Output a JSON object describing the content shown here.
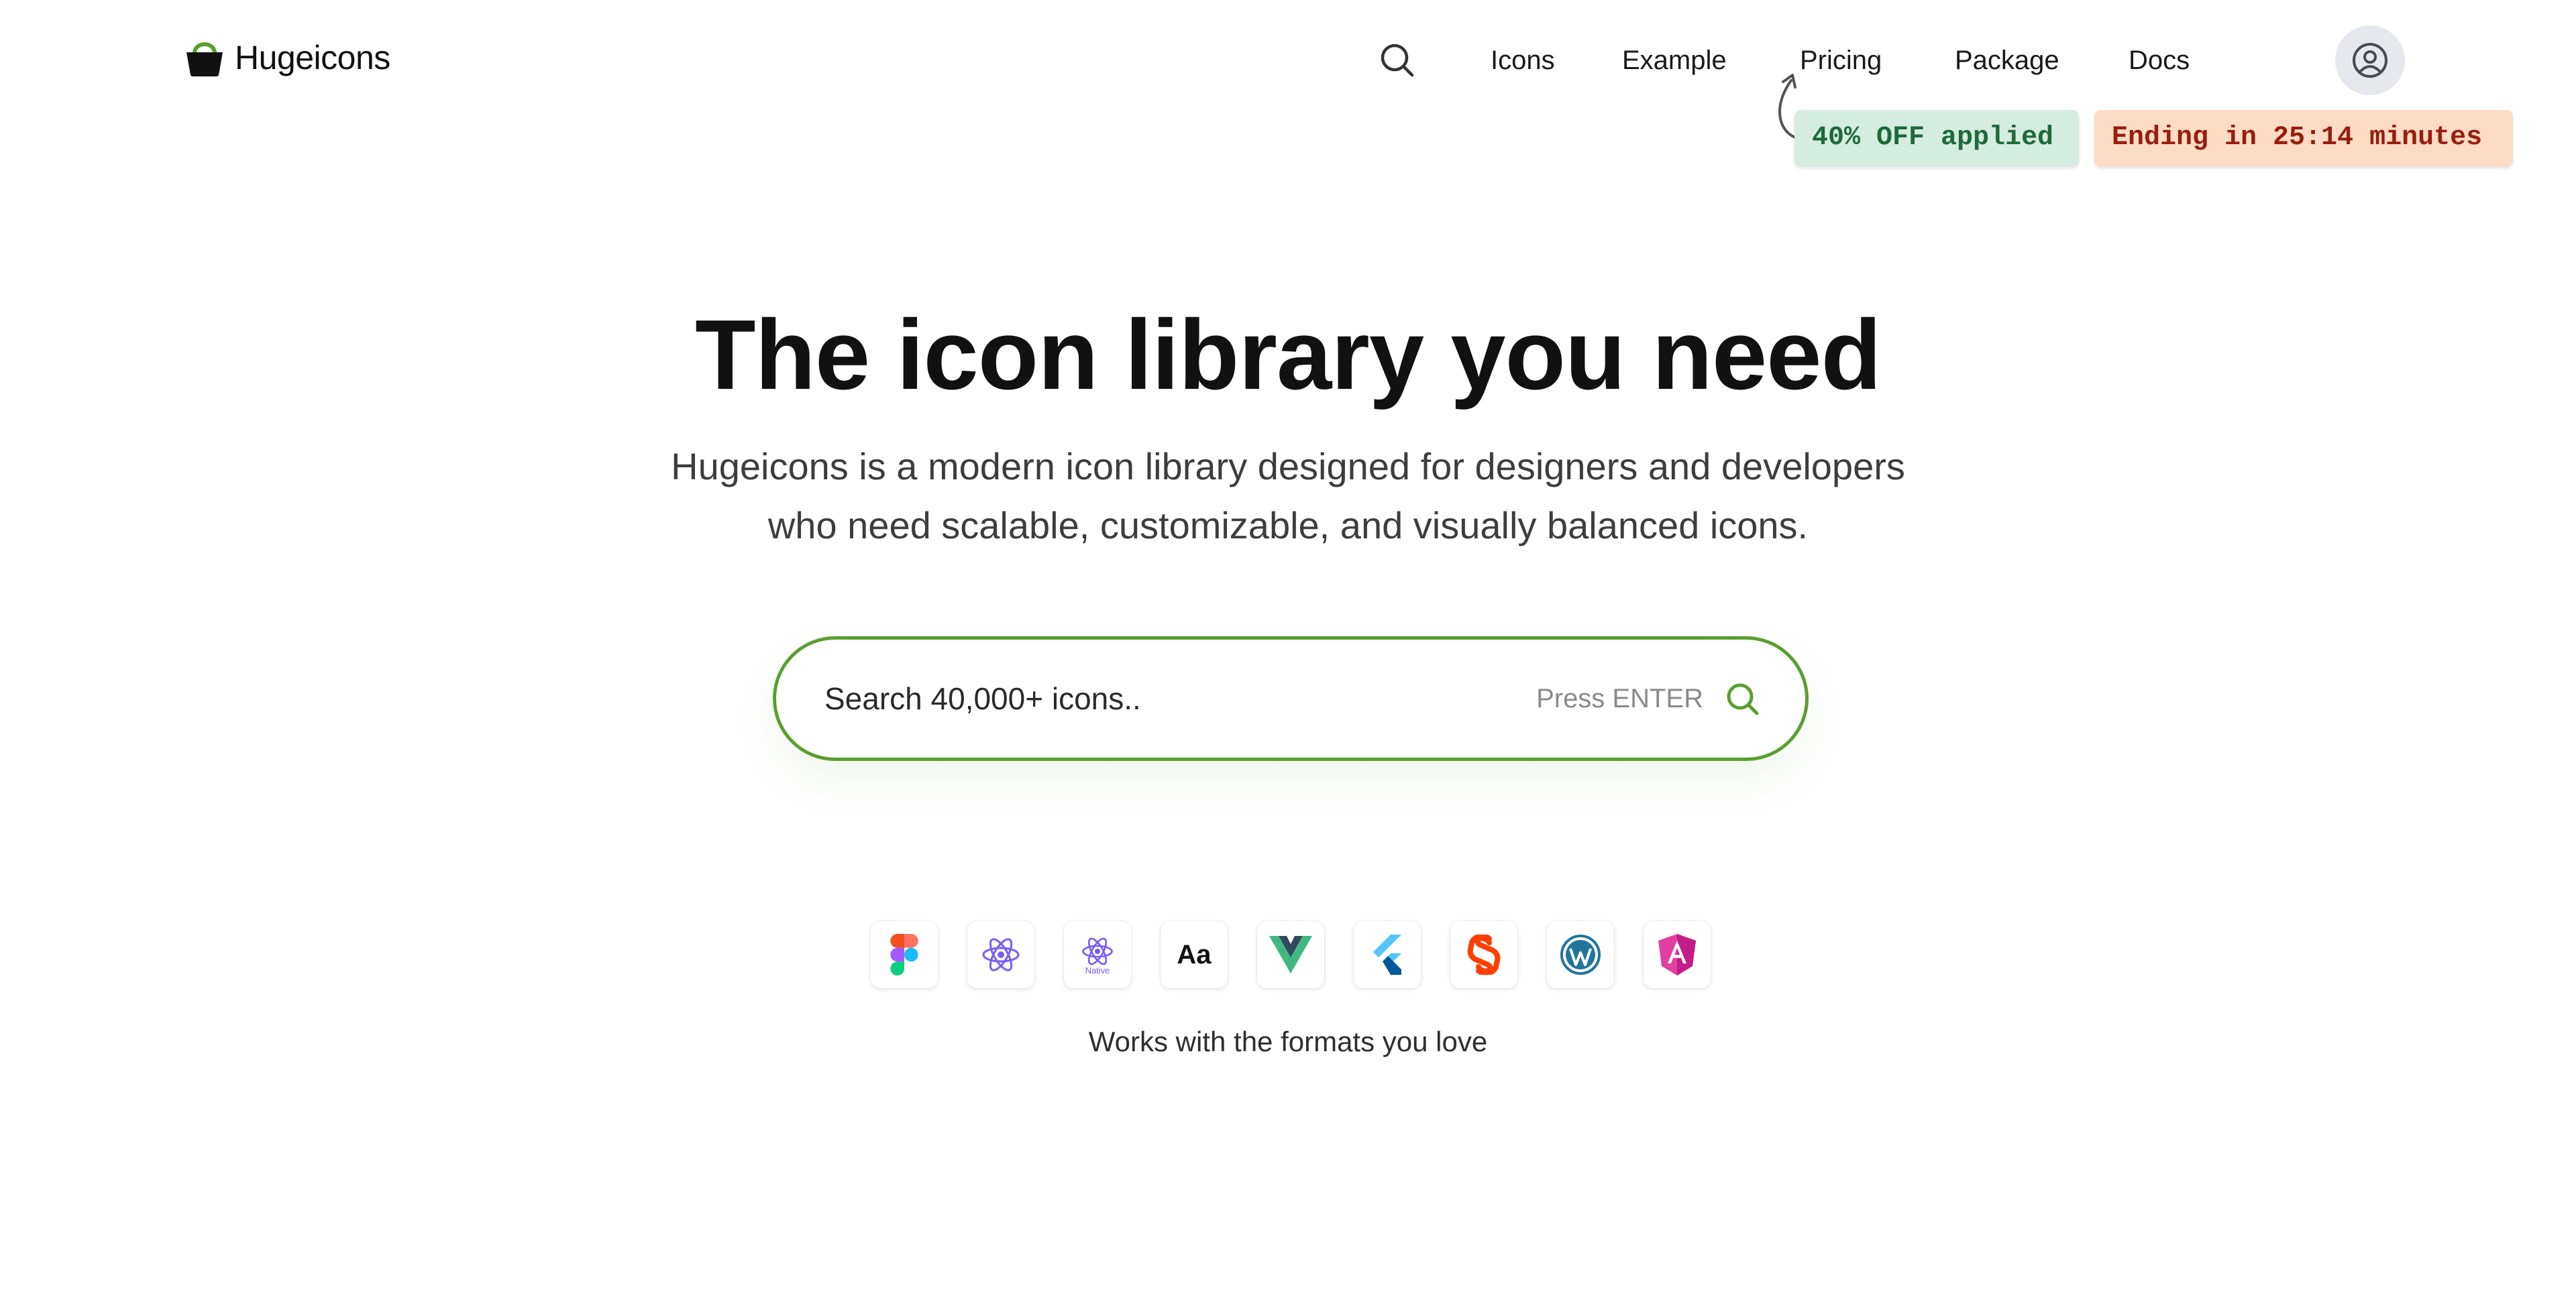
{
  "brand": {
    "name": "Hugeicons",
    "logo_icon": "basket-logo-icon",
    "accent_color": "#5b9e2f"
  },
  "nav": {
    "search_icon": "search-icon",
    "items": [
      "Icons",
      "Example",
      "Pricing",
      "Package",
      "Docs"
    ],
    "avatar_icon": "user-circle-icon"
  },
  "promo": {
    "discount_label": "40% OFF applied",
    "timer_label": "Ending in 25:14 minutes",
    "discount_color": "#1d6b3b",
    "timer_color": "#9a1d0d"
  },
  "hero": {
    "title": "The icon library you need",
    "subtitle_line1": "Hugeicons is a modern icon library designed for designers and developers",
    "subtitle_line2": "who need scalable, customizable, and visually balanced icons."
  },
  "search": {
    "placeholder": "Search 40,000+ icons..",
    "hint": "Press ENTER",
    "icon": "search-icon"
  },
  "formats": {
    "items": [
      {
        "name": "figma",
        "icon": "figma-icon"
      },
      {
        "name": "react",
        "icon": "react-icon"
      },
      {
        "name": "react-native",
        "icon": "react-native-icon",
        "label": "Native"
      },
      {
        "name": "font",
        "icon": "font-icon",
        "label": "Aa"
      },
      {
        "name": "vue",
        "icon": "vue-icon"
      },
      {
        "name": "flutter",
        "icon": "flutter-icon"
      },
      {
        "name": "svelte",
        "icon": "svelte-icon"
      },
      {
        "name": "wordpress",
        "icon": "wordpress-icon"
      },
      {
        "name": "angular",
        "icon": "angular-icon"
      }
    ],
    "caption": "Works with the formats you love"
  }
}
